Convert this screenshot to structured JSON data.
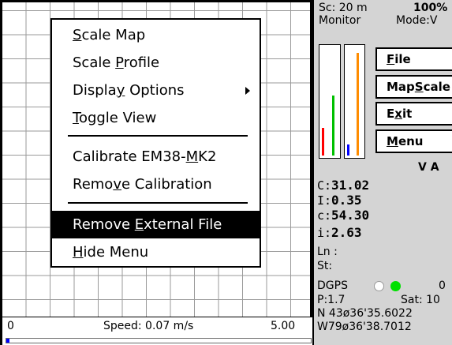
{
  "menu": {
    "items": [
      {
        "label": "Scale Map"
      },
      {
        "label": "Scale Profile"
      },
      {
        "label": "Display Options",
        "has_submenu": true
      },
      {
        "label": "Toggle View"
      },
      {
        "label": "Calibrate EM38-MK2"
      },
      {
        "label": "Remove Calibration"
      },
      {
        "label": "Remove External File",
        "selected": true
      },
      {
        "label": "Hide Menu"
      }
    ]
  },
  "speedbar": {
    "left_value": "0",
    "speed_text": "Speed: 0.07 m/s",
    "right_value": "5.00",
    "progress_fraction": 0.01
  },
  "panel": {
    "scale_text": "Sc:  20 m",
    "percent_text": "100%",
    "monitor_text": "Monitor",
    "mode_text": "Mode:V",
    "buttons": {
      "file": "File",
      "mapscale": "MapScale",
      "exit": "Exit",
      "menu": "Menu"
    },
    "va_text": "V  A",
    "readings": {
      "C_label": "C:",
      "C_value": "31.02",
      "I_label": "I:",
      "I_value": "0.35",
      "c_label": "c:",
      "c_value": "54.30",
      "i_label": "i:",
      "i_value": "2.63",
      "ln_text": "Ln :",
      "st_text": "St:"
    },
    "gps": {
      "dgps_label": "DGPS",
      "count": "0",
      "p_text": "P:1.7",
      "sat_text": "Sat: 10",
      "lat_text": "N 43ø36'35.6022",
      "lon_text": "W79ø36'38.7012"
    },
    "gauges": {
      "left": [
        {
          "color": "#ff0000",
          "level": 0.25
        },
        {
          "color": "#00c000",
          "level": 0.55
        }
      ],
      "right": [
        {
          "color": "#0000ff",
          "level": 0.1
        },
        {
          "color": "#ff8c00",
          "level": 0.94
        }
      ]
    },
    "colors": {
      "dot_white": "#ffffff",
      "dot_green": "#00e000"
    }
  }
}
